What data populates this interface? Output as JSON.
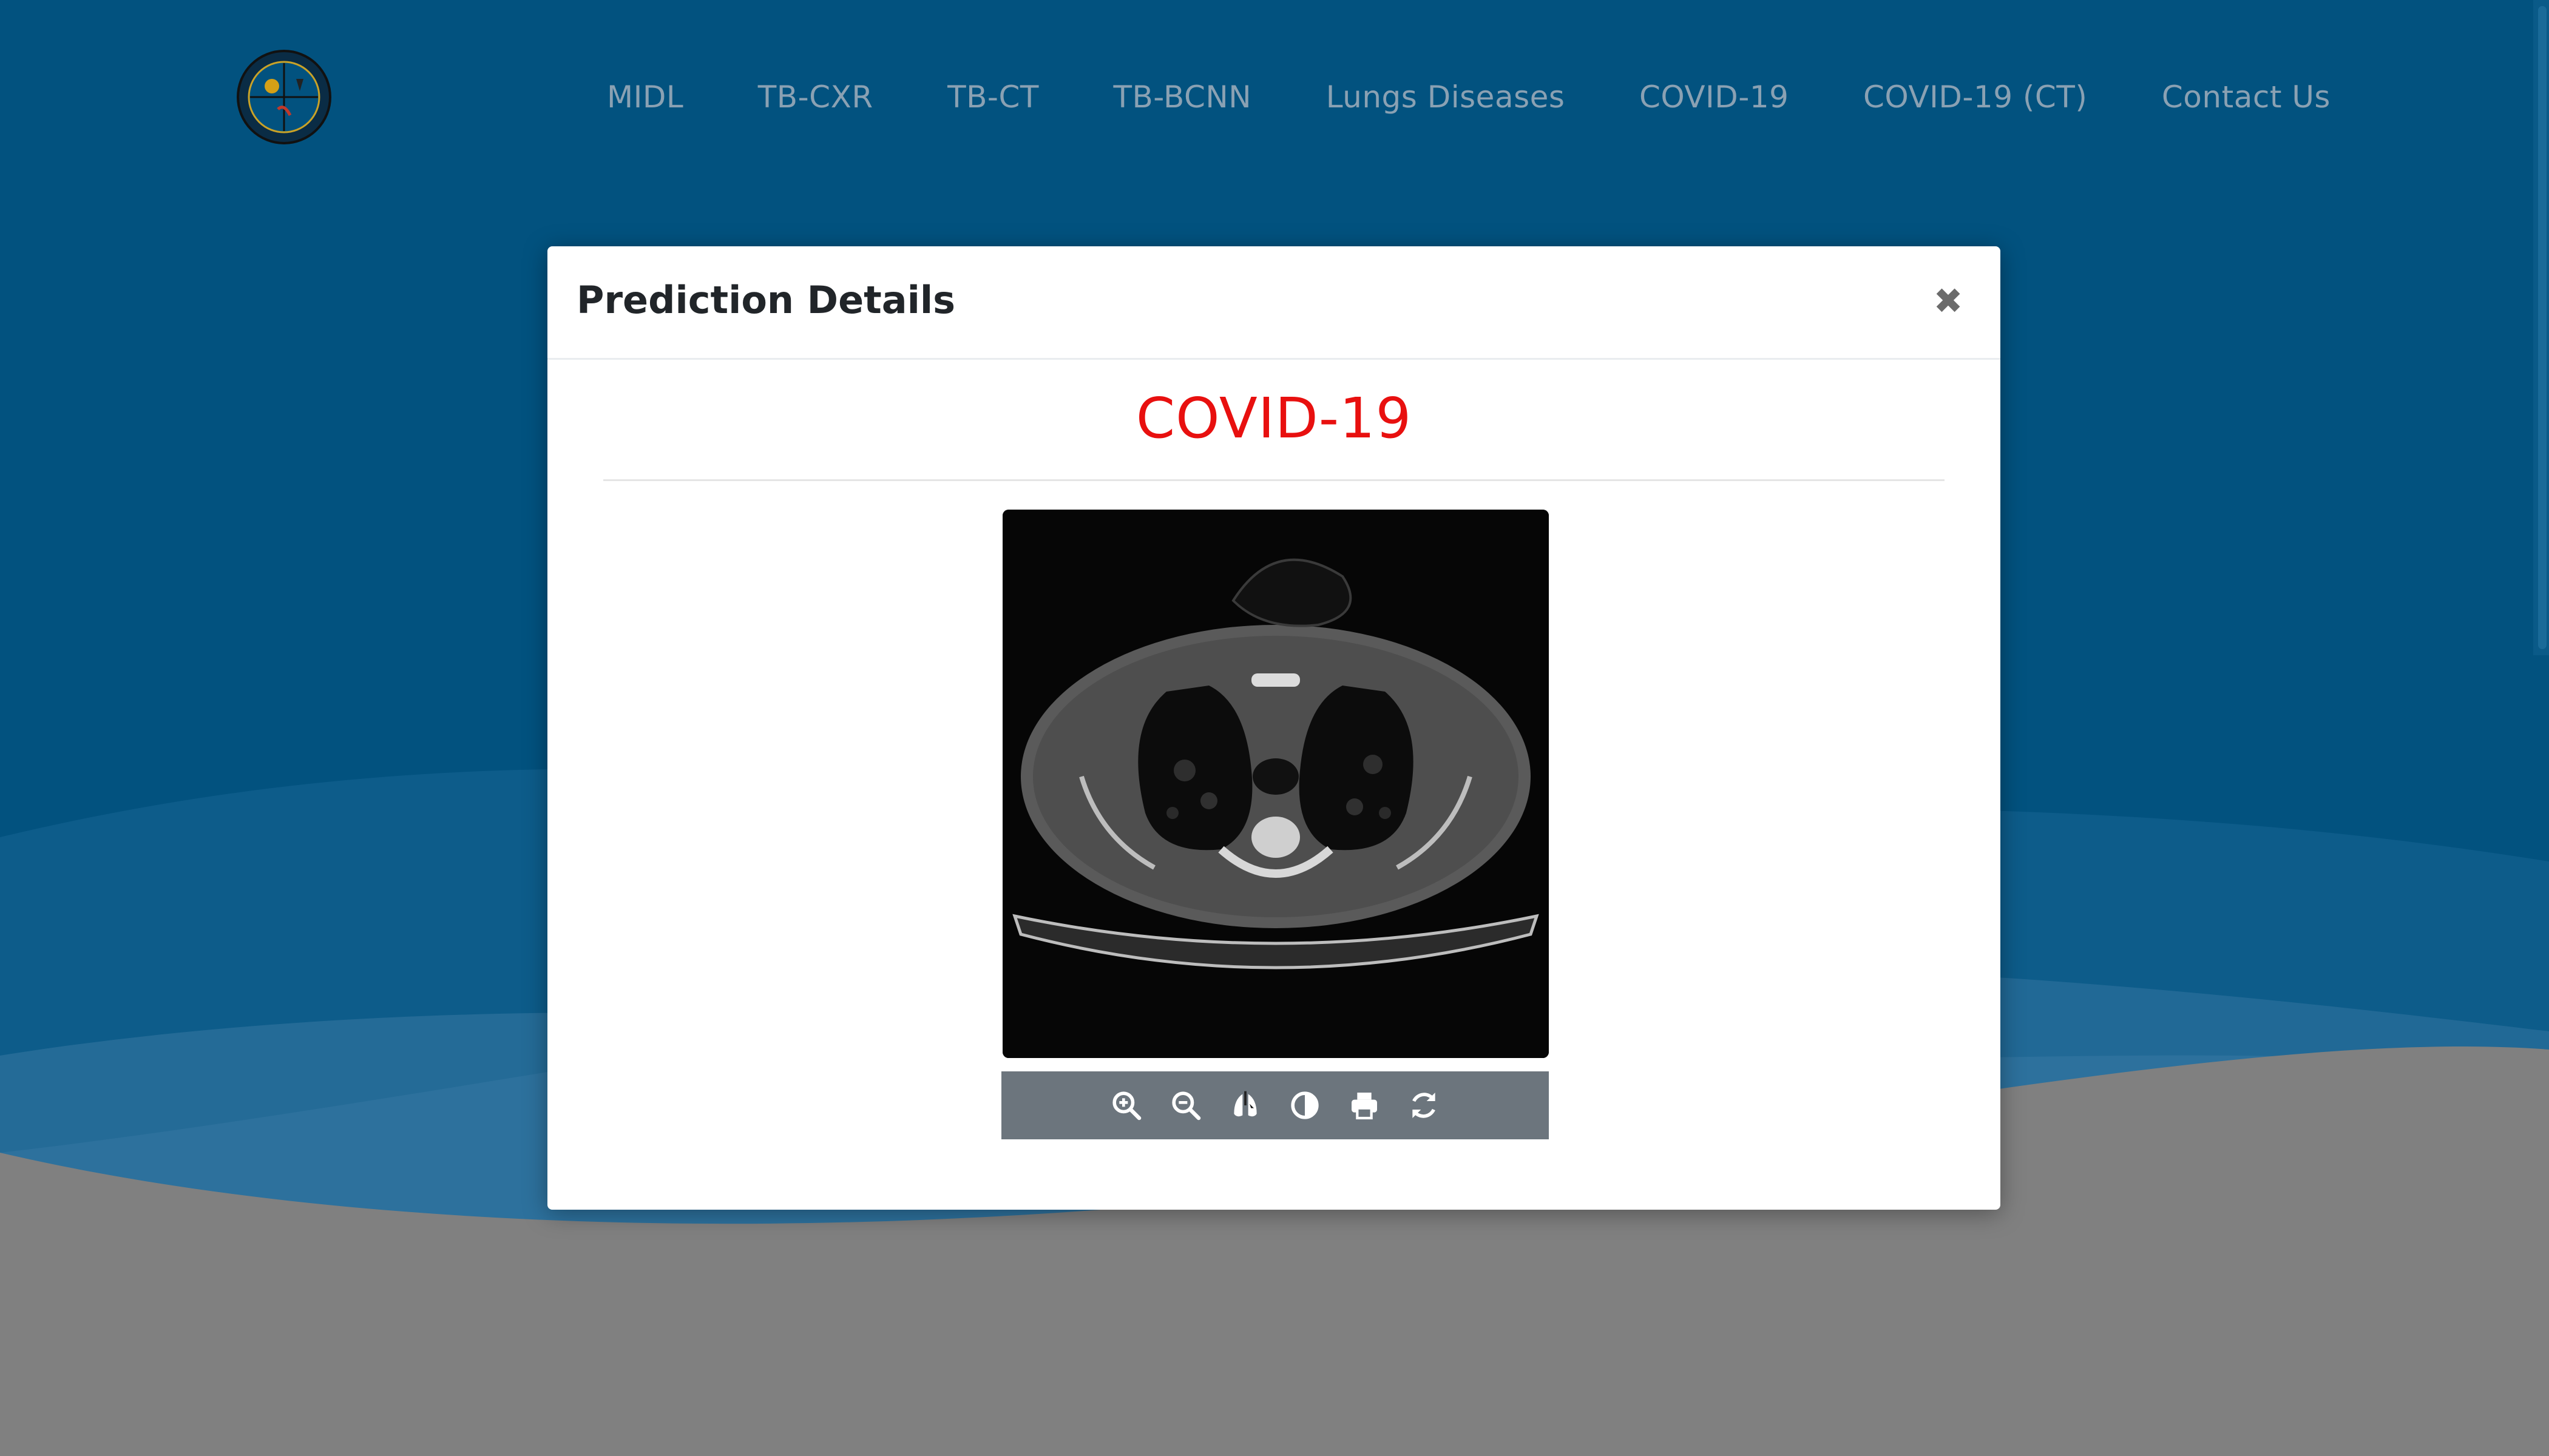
{
  "nav": {
    "logo_icon": "institution-seal-logo",
    "items": [
      "MIDL",
      "TB-CXR",
      "TB-CT",
      "TB-BCNN",
      "Lungs Diseases",
      "COVID-19",
      "COVID-19 (CT)",
      "Contact Us"
    ]
  },
  "modal": {
    "title": "Prediction Details",
    "close_glyph": "✖",
    "result": "COVID-19",
    "image_icon": "ct-scan-image",
    "toolbar": [
      "zoom-in-icon",
      "zoom-out-icon",
      "lungs-icon",
      "contrast-icon",
      "print-icon",
      "refresh-icon"
    ]
  },
  "colors": {
    "header_blue": "#02527f",
    "result_red": "#e8100f",
    "toolbar_gray": "#6c757d",
    "page_gray": "#808080"
  }
}
